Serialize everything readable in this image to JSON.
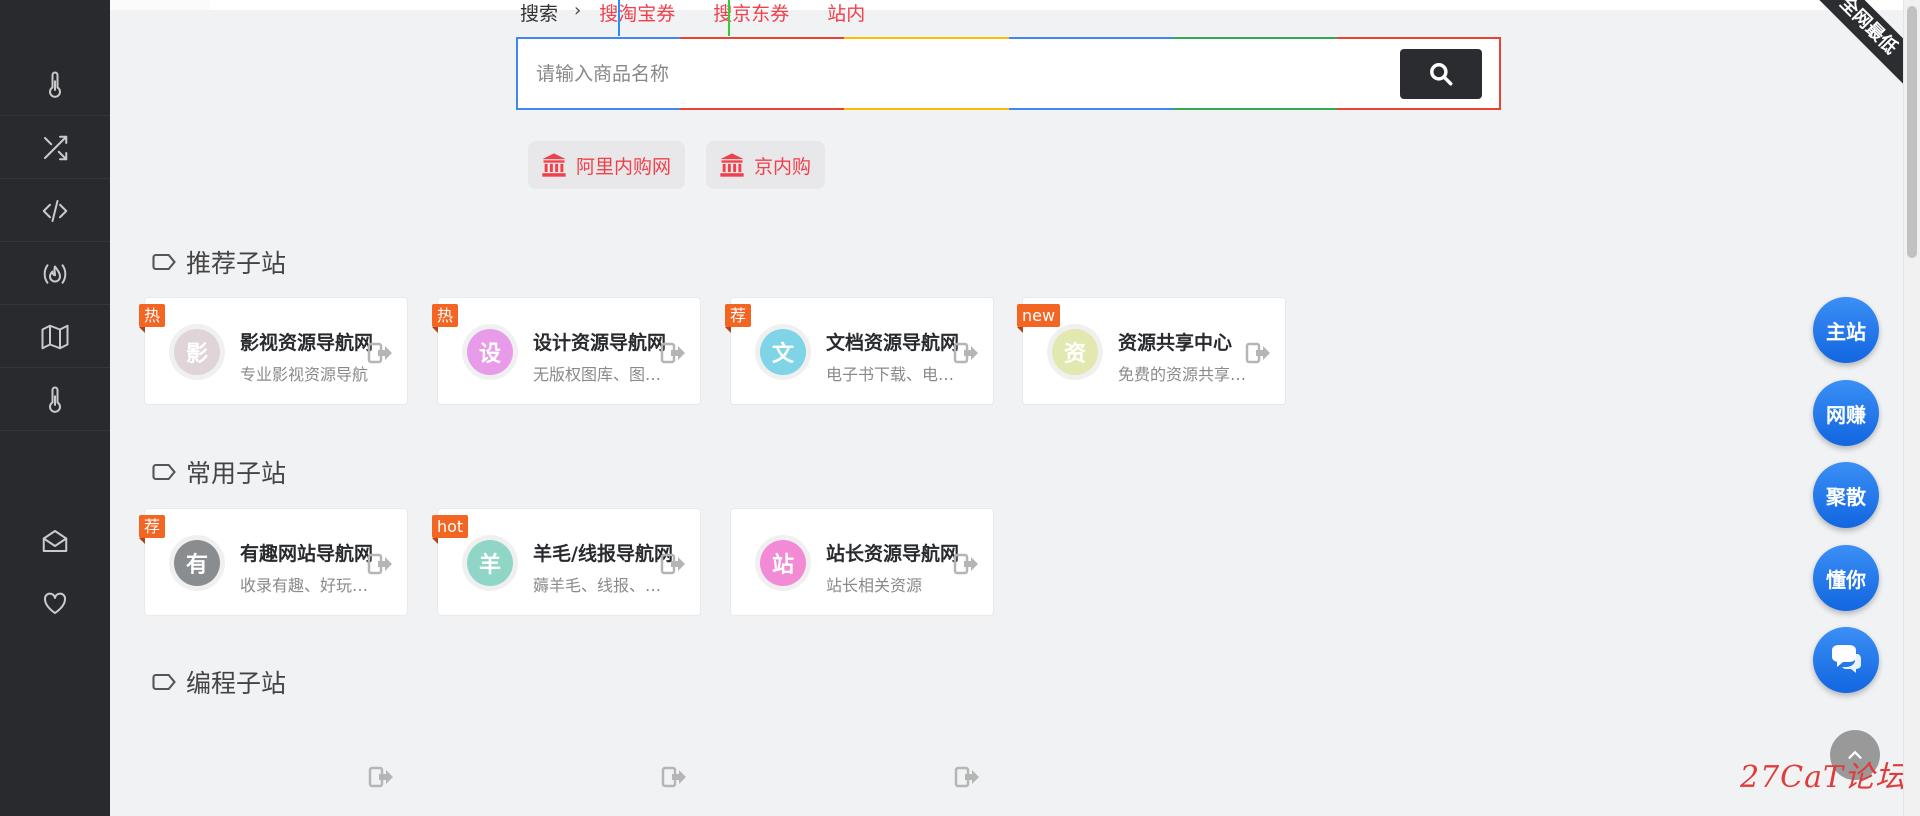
{
  "sidebar": {
    "items": [
      {
        "icon": "thermometer-icon"
      },
      {
        "icon": "shuffle-icon"
      },
      {
        "icon": "code-icon"
      },
      {
        "icon": "fire-code-icon"
      },
      {
        "icon": "map-icon"
      },
      {
        "icon": "thermometer-icon"
      },
      {
        "icon": "mail-open-icon"
      },
      {
        "icon": "heart-icon"
      }
    ]
  },
  "corner_ribbon": "全网最低",
  "search": {
    "label": "搜索",
    "tabs": [
      "搜淘宝券",
      "搜京东券",
      "站内"
    ],
    "placeholder": "请输入商品名称",
    "border_colors": [
      "#4285f4",
      "#ea4335",
      "#fbbc05",
      "#4285f4",
      "#34a853",
      "#ea4335"
    ]
  },
  "quick_links": [
    "阿里内购网",
    "京内购"
  ],
  "sections": [
    {
      "title": "推荐子站",
      "cards": [
        {
          "badge": "热",
          "avatar": "影",
          "avatar_color": "#e0d4d8",
          "title": "影视资源导航网",
          "desc": "专业影视资源导航"
        },
        {
          "badge": "热",
          "avatar": "设",
          "avatar_color": "#e89be8",
          "title": "设计资源导航网",
          "desc": "无版权图库、图标素材"
        },
        {
          "badge": "荐",
          "avatar": "文",
          "avatar_color": "#7fd4e8",
          "title": "文档资源导航网",
          "desc": "电子书下载、电子文档"
        },
        {
          "badge": "new",
          "avatar": "资",
          "avatar_color": "#e2e8b0",
          "title": "资源共享中心",
          "desc": "免费的资源共享平台"
        }
      ]
    },
    {
      "title": "常用子站",
      "cards": [
        {
          "badge": "荐",
          "avatar": "有",
          "avatar_color": "#8a8d8f",
          "title": "有趣网站导航网",
          "desc": "收录有趣、好玩的网站"
        },
        {
          "badge": "hot",
          "avatar": "羊",
          "avatar_color": "#8fd6c6",
          "title": "羊毛/线报导航网",
          "desc": "薅羊毛、线报、优惠"
        },
        {
          "badge": "",
          "avatar": "站",
          "avatar_color": "#f28ad6",
          "title": "站长资源导航网",
          "desc": "站长相关资源"
        }
      ]
    },
    {
      "title": "编程子站",
      "cards": []
    }
  ],
  "float_buttons": [
    "主站",
    "网赚",
    "聚散",
    "懂你"
  ],
  "watermark": "27CaT论坛"
}
